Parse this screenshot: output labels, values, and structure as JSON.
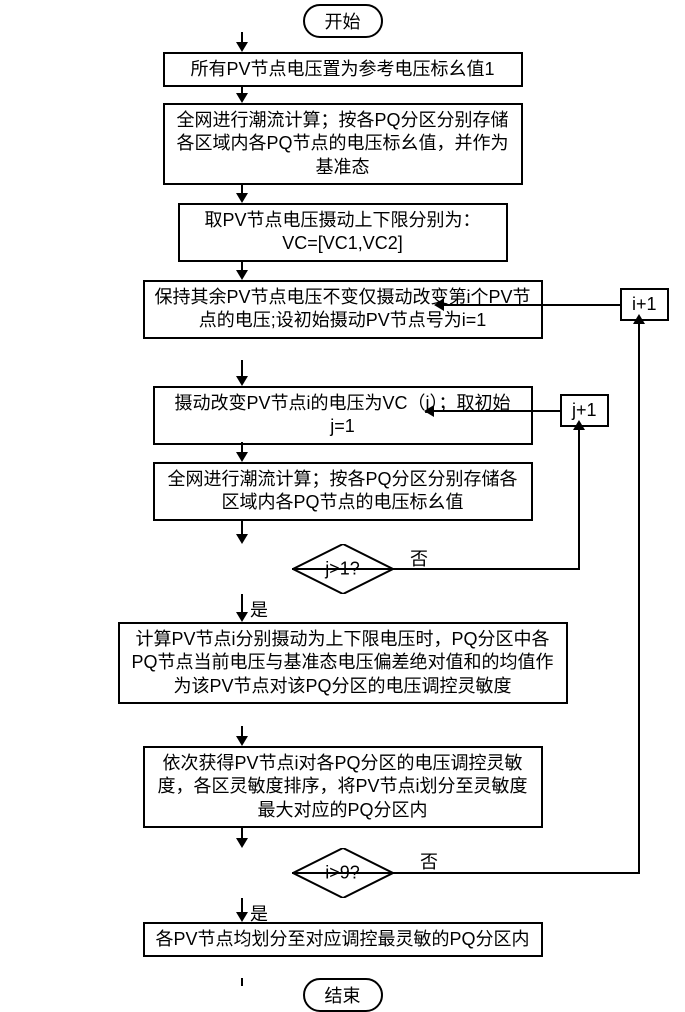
{
  "terminators": {
    "start": "开始",
    "end": "结束"
  },
  "processes": {
    "p1": "所有PV节点电压置为参考电压标幺值1",
    "p2": "全网进行潮流计算；按各PQ分区分别存储各区域内各PQ节点的电压标幺值，并作为基准态",
    "p3": "取PV节点电压摄动上下限分别为：VC=[VC1,VC2]",
    "p4": "保持其余PV节点电压不变仅摄动改变第i个PV节点的电压;设初始摄动PV节点号为i=1",
    "p5": "摄动改变PV节点i的电压为VC（j）；取初始j=1",
    "p6": "全网进行潮流计算；按各PQ分区分别存储各区域内各PQ节点的电压标幺值",
    "p7": "计算PV节点i分别摄动为上下限电压时，PQ分区中各PQ节点当前电压与基准态电压偏差绝对值和的均值作为该PV节点对该PQ分区的电压调控灵敏度",
    "p8": "依次获得PV节点i对各PQ分区的电压调控灵敏度，各区灵敏度排序，将PV节点i划分至灵敏度最大对应的PQ分区内",
    "p9": "各PV节点均划分至对应调控最灵敏的PQ分区内"
  },
  "decisions": {
    "d1": "j>1?",
    "d2": "i>9?"
  },
  "labels": {
    "yes": "是",
    "no": "否"
  },
  "loops": {
    "inc_i": "i+1",
    "inc_j": "j+1"
  }
}
